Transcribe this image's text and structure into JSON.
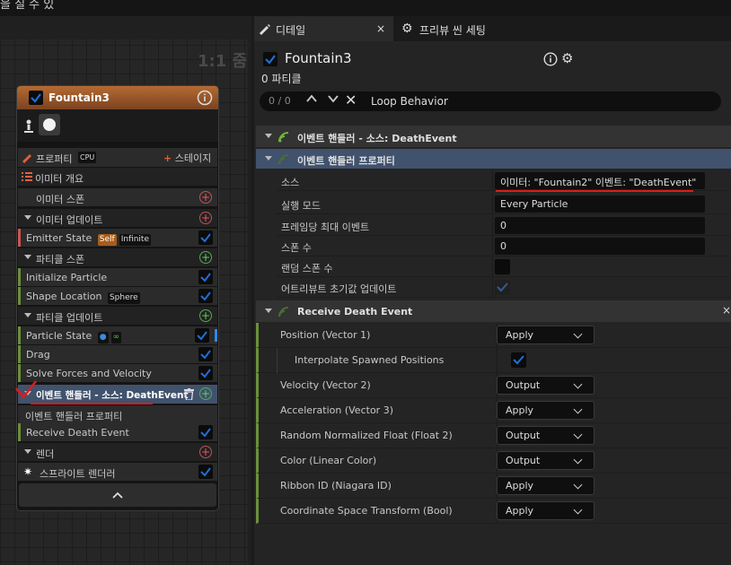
{
  "top": {
    "title_fragment": "을 칠 수 있"
  },
  "graph": {
    "zoom_label": "1:1 줌"
  },
  "node": {
    "title": "Fountain3",
    "rows": {
      "properties": "프로퍼티",
      "properties_badge": "CPU",
      "stage_button": "스테이지",
      "emitter_summary": "이미터 개요",
      "emitter_spawn": "이미터 스폰",
      "emitter_update": "이미터 업데이트",
      "emitter_state": "Emitter State",
      "emitter_state_tag_self": "Self",
      "emitter_state_tag_inf": "Infinite",
      "particle_spawn": "파티클 스폰",
      "initialize_particle": "Initialize Particle",
      "shape_location": "Shape Location",
      "shape_location_tag": "Sphere",
      "particle_update": "파티클 업데이트",
      "particle_state": "Particle State",
      "particle_state_tag_loop": "∞",
      "drag": "Drag",
      "solve_forces": "Solve Forces and Velocity",
      "event_handler": "이벤트 핸들러 - 소스: DeathEvent",
      "event_handler_props": "이벤트 핸들러 프로퍼티",
      "receive_death": "Receive Death Event",
      "render": "렌더",
      "sprite_renderer": "스프라이트 렌더러"
    }
  },
  "details": {
    "tabs": [
      {
        "label": "디테일"
      },
      {
        "label": "프리뷰 씬 세팅"
      }
    ],
    "object_name": "Fountain3",
    "particle_count": "0 파티클",
    "search": {
      "index": "0 / 0",
      "query": "Loop Behavior"
    },
    "categories": {
      "event_source": "이벤트 핸들러 - 소스: DeathEvent",
      "event_props": "이벤트 핸들러 프로퍼티",
      "receive_death": "Receive Death Event"
    },
    "props": [
      {
        "label": "소스",
        "value": "이미터: \"Fountain2\" 이벤트: \"DeathEvent\""
      },
      {
        "label": "실행 모드",
        "value": "Every Particle"
      },
      {
        "label": "프레임당 최대 이벤트",
        "value": "0"
      },
      {
        "label": "스폰 수",
        "value": "0"
      },
      {
        "label": "랜덤 스폰 수",
        "value": ""
      },
      {
        "label": "어트리뷰트 초기값 업데이트",
        "value": ""
      }
    ],
    "receive": [
      {
        "label": "Position (Vector 1)",
        "value": "Apply"
      },
      {
        "label": "Interpolate Spawned Positions",
        "value": ""
      },
      {
        "label": "Velocity (Vector 2)",
        "value": "Output"
      },
      {
        "label": "Acceleration (Vector 3)",
        "value": "Apply"
      },
      {
        "label": "Random Normalized Float (Float 2)",
        "value": "Output"
      },
      {
        "label": "Color (Linear Color)",
        "value": "Output"
      },
      {
        "label": "Ribbon ID (Niagara ID)",
        "value": "Apply"
      },
      {
        "label": "Coordinate Space Transform (Bool)",
        "value": "Apply"
      }
    ]
  },
  "colors": {
    "accent": "#1f6fd6",
    "annotation": "#e01a1a",
    "node_header": "#b56a32"
  }
}
